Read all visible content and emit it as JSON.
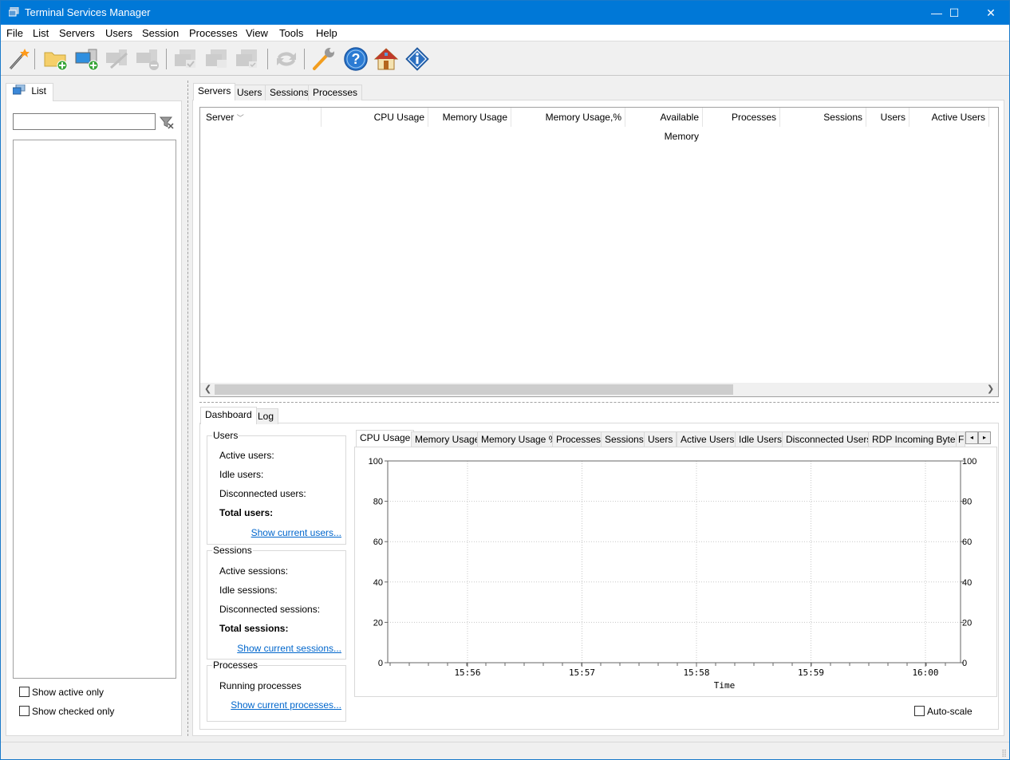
{
  "window": {
    "title": "Terminal Services Manager",
    "minimize_glyph": "—",
    "maximize_glyph": "☐",
    "close_glyph": "✕"
  },
  "menu": [
    "File",
    "List",
    "Servers",
    "Users",
    "Session",
    "Processes",
    "View",
    "Tools",
    "Help"
  ],
  "toolbar": {
    "buttons": [
      {
        "name": "wizard-icon",
        "enabled": true
      },
      {
        "name": "add-folder-icon",
        "enabled": true
      },
      {
        "name": "add-server-icon",
        "enabled": true
      },
      {
        "name": "edit-server-icon",
        "enabled": false
      },
      {
        "name": "remove-server-icon",
        "enabled": false
      },
      {
        "name": "check-server-icon",
        "enabled": false
      },
      {
        "name": "uncheck-server-icon",
        "enabled": false
      },
      {
        "name": "check-all-servers-icon",
        "enabled": false
      },
      {
        "name": "refresh-icon",
        "enabled": false
      },
      {
        "name": "settings-wrench-icon",
        "enabled": true
      },
      {
        "name": "help-icon",
        "enabled": true
      },
      {
        "name": "home-icon",
        "enabled": true
      },
      {
        "name": "info-icon",
        "enabled": true
      }
    ]
  },
  "left_panel": {
    "tab_label": "List",
    "filter_value": "",
    "show_active_only": {
      "label": "Show active only",
      "checked": false
    },
    "show_checked_only": {
      "label": "Show checked only",
      "checked": false
    }
  },
  "main_tabs": [
    "Servers",
    "Users",
    "Sessions",
    "Processes"
  ],
  "servers_table": {
    "columns": [
      "Server",
      "CPU Usage",
      "Memory Usage",
      "Memory Usage,%",
      "Available Memory",
      "Processes",
      "Sessions",
      "Users",
      "Active Users"
    ],
    "rows": []
  },
  "bottom_tabs": [
    "Dashboard",
    "Log"
  ],
  "dashboard": {
    "users": {
      "title": "Users",
      "active": "Active users:",
      "idle": "Idle users:",
      "disconnected": "Disconnected users:",
      "total": "Total users:",
      "link": "Show current users..."
    },
    "sessions": {
      "title": "Sessions",
      "active": "Active sessions:",
      "idle": "Idle sessions:",
      "disconnected": "Disconnected sessions:",
      "total": "Total sessions:",
      "link": "Show current sessions..."
    },
    "processes": {
      "title": "Processes",
      "running": "Running processes",
      "link": "Show current processes..."
    },
    "chart_tabs": [
      "CPU Usage",
      "Memory Usage",
      "Memory Usage %",
      "Processes",
      "Sessions",
      "Users",
      "Active Users",
      "Idle Users",
      "Disconnected Users",
      "RDP Incoming Bytes",
      "F"
    ],
    "auto_scale": {
      "label": "Auto-scale",
      "checked": false
    }
  },
  "chart_data": {
    "type": "line",
    "title": "CPU Usage",
    "xlabel": "Time",
    "ylabel": "",
    "x_ticks": [
      "15:56",
      "15:57",
      "15:58",
      "15:59",
      "16:00"
    ],
    "y_ticks": [
      0,
      20,
      40,
      60,
      80,
      100
    ],
    "ylim": [
      0,
      100
    ],
    "series": [],
    "grid": true
  }
}
